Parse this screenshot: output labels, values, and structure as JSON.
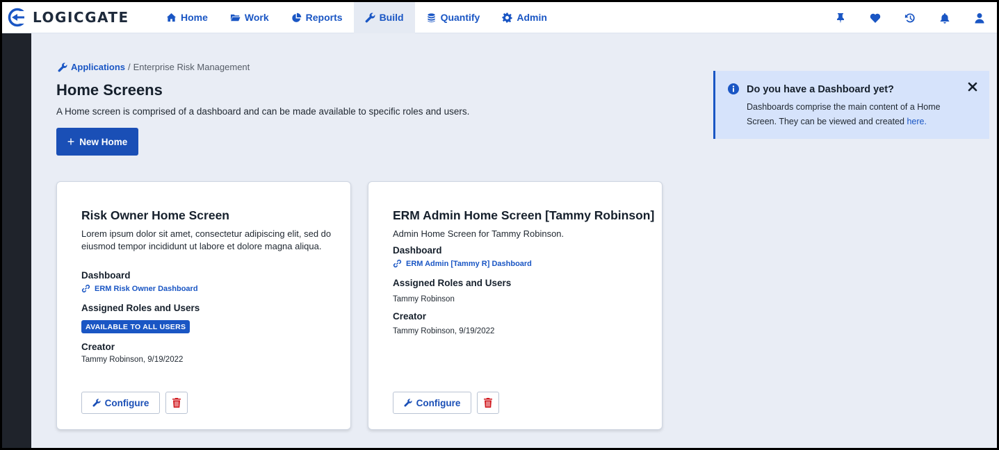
{
  "brand": {
    "name": "LOGICGATE"
  },
  "nav": {
    "items": [
      {
        "label": "Home",
        "icon": "home-icon"
      },
      {
        "label": "Work",
        "icon": "folder-icon"
      },
      {
        "label": "Reports",
        "icon": "pie-chart-icon"
      },
      {
        "label": "Build",
        "icon": "wrench-icon",
        "active": true
      },
      {
        "label": "Quantify",
        "icon": "coins-icon"
      },
      {
        "label": "Admin",
        "icon": "gear-icon"
      }
    ],
    "right_icons": [
      "pin-icon",
      "heart-icon",
      "history-icon",
      "bell-icon",
      "user-icon"
    ]
  },
  "breadcrumb": {
    "link": "Applications",
    "separator": "/",
    "current": "Enterprise Risk Management"
  },
  "page": {
    "title": "Home Screens",
    "description": "A Home screen is comprised of a dashboard and can be made available to specific roles and users.",
    "new_button": "New Home"
  },
  "info": {
    "title": "Do you have a Dashboard yet?",
    "text": "Dashboards comprise the main content of a Home Screen. They can be viewed and created ",
    "link": "here."
  },
  "cards": [
    {
      "title": "Risk Owner Home Screen",
      "description": "Lorem ipsum dolor sit amet, consectetur adipiscing elit, sed do eiusmod tempor incididunt ut labore et dolore magna aliqua.",
      "dashboard_label": "Dashboard",
      "dashboard_link": "ERM Risk Owner Dashboard",
      "roles_label": "Assigned Roles and Users",
      "roles_badge": "AVAILABLE TO ALL USERS",
      "creator_label": "Creator",
      "creator": "Tammy Robinson, 9/19/2022",
      "configure": "Configure"
    },
    {
      "title": "ERM Admin Home Screen [Tammy Robinson]",
      "description": "Admin Home Screen for Tammy Robinson.",
      "dashboard_label": "Dashboard",
      "dashboard_link": "ERM Admin [Tammy R] Dashboard",
      "roles_label": "Assigned Roles and Users",
      "roles_value": "Tammy Robinson",
      "creator_label": "Creator",
      "creator": "Tammy Robinson, 9/19/2022",
      "configure": "Configure"
    }
  ],
  "colors": {
    "accent": "#1a56c4",
    "primary_button": "#1a4fb6",
    "background": "#e9edf5",
    "info_background": "#d6e3fb",
    "sidebar": "#1f232b",
    "delete": "#d0191f"
  }
}
